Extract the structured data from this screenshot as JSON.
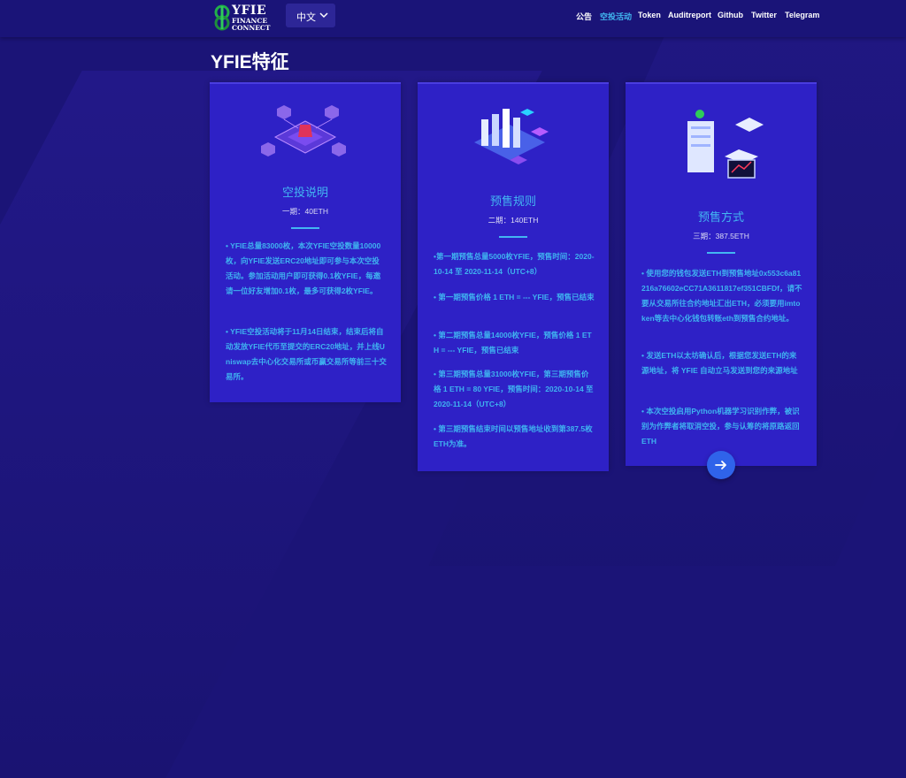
{
  "header": {
    "logo": {
      "line1": "YFIE",
      "line2": "FINANCE CONNECT"
    },
    "language": "中文",
    "nav": [
      "公告",
      "空投活动",
      "Token",
      "Auditreport",
      "Github",
      "Twitter",
      "Telegram"
    ],
    "active_nav": "空投活动"
  },
  "section_title": "YFIE特征",
  "cards": [
    {
      "title": "空投说明",
      "subtitle": "一期：40ETH",
      "paragraphs": [
        "• YFIE总量83000枚，本次YFIE空投数量10000枚，向YFIE发送ERC20地址即可参与本次空投活动。参加活动用户即可获得0.1枚YFIE，每邀请一位好友增加0.1枚，最多可获得2枚YFIE。",
        "• YFIE空投活动将于11月14日结束，结束后将自动发放YFIE代币至提交的ERC20地址，并上线Uniswap去中心化交易所或币赢交易所等前三十交易所。"
      ]
    },
    {
      "title": "预售规则",
      "subtitle": "二期：140ETH",
      "paragraphs": [
        "•第一期预售总量5000枚YFIE，预售时间：2020-10-14 至 2020-11-14（UTC+8）",
        "• 第一期预售价格 1 ETH = --- YFIE，预售已结束",
        "• 第二期预售总量14000枚YFIE，预售价格 1 ETH = --- YFIE，预售已结束",
        "• 第三期预售总量31000枚YFIE，第三期预售价格 1 ETH = 80 YFIE，预售时间：2020-10-14 至 2020-11-14（UTC+8）",
        "• 第三期预售结束时间以预售地址收到第387.5枚ETH为准。"
      ]
    },
    {
      "title": "预售方式",
      "subtitle": "三期：387.5ETH",
      "paragraphs": [
        "• 使用您的钱包发送ETH到预售地址0x553c6a81216a76602eCC71A3611817ef351CBFDf，请不要从交易所往合约地址汇出ETH，必须要用imtoken等去中心化钱包转账eth到预售合约地址。",
        "• 发送ETH以太坊确认后，根据您发送ETH的来源地址，将 YFIE 自动立马发送到您的来源地址",
        "• 本次空投启用Python机器学习识别作弊，被识别为作弊者将取消空投，参与认筹的将原路返回 ETH"
      ]
    }
  ],
  "colors": {
    "background": "#1b1477",
    "card": "#2e21c6",
    "accent": "#43b6f2",
    "fab": "#2f63ea"
  },
  "icons": {
    "language_dropdown": "chevron-down-icon",
    "fab": "arrow-right-icon"
  }
}
